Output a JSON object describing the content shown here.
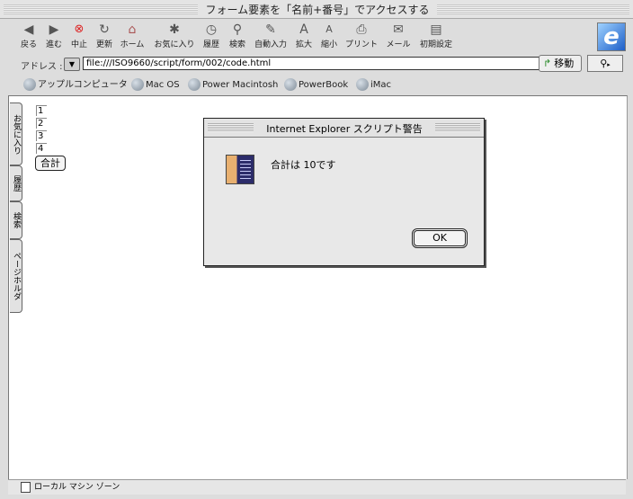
{
  "window": {
    "title": "フォーム要素を「名前+番号」でアクセスする"
  },
  "toolbar": {
    "buttons": [
      {
        "label": "戻る",
        "icon": "back-arrow-icon"
      },
      {
        "label": "進む",
        "icon": "forward-arrow-icon"
      },
      {
        "label": "中止",
        "icon": "stop-icon"
      },
      {
        "label": "更新",
        "icon": "refresh-icon"
      },
      {
        "label": "ホーム",
        "icon": "home-icon"
      },
      {
        "label": "お気に入り",
        "icon": "favorites-icon"
      },
      {
        "label": "履歴",
        "icon": "history-icon"
      },
      {
        "label": "検索",
        "icon": "search-icon"
      },
      {
        "label": "自動入力",
        "icon": "autofill-icon"
      },
      {
        "label": "拡大",
        "icon": "larger-text-icon"
      },
      {
        "label": "縮小",
        "icon": "smaller-text-icon"
      },
      {
        "label": "プリント",
        "icon": "print-icon"
      },
      {
        "label": "メール",
        "icon": "mail-icon"
      },
      {
        "label": "初期設定",
        "icon": "preferences-icon"
      }
    ]
  },
  "address": {
    "label": "アドレス :",
    "url": "file:///ISO9660/script/form/002/code.html",
    "go_label": "移動"
  },
  "favorites_bar": [
    "アップルコンピュータ",
    "Mac OS",
    "Power Macintosh",
    "PowerBook",
    "iMac"
  ],
  "side_tabs": [
    "お気に入り",
    "履歴",
    "検索",
    "ページホルダ"
  ],
  "page": {
    "fields": [
      "1",
      "2",
      "3",
      "4"
    ],
    "sum_button": "合計"
  },
  "dialog": {
    "title": "Internet Explorer スクリプト警告",
    "message": "合計は 10です",
    "ok_label": "OK"
  },
  "status": {
    "zone": "ローカル マシン ゾーン"
  }
}
